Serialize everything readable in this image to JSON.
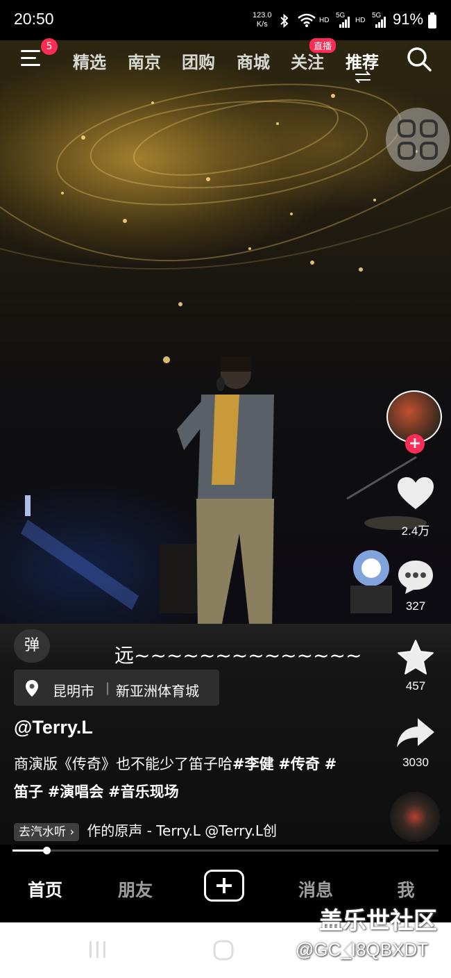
{
  "status_bar": {
    "time": "20:50",
    "net_speed_value": "123.0",
    "net_speed_unit": "K/s",
    "hd1": "HD",
    "net1": "5G",
    "hd2": "HD",
    "net2": "5G",
    "battery": "91%"
  },
  "top_nav": {
    "menu_badge": "5",
    "tabs": [
      {
        "label": "精选"
      },
      {
        "label": "南京"
      },
      {
        "label": "团购"
      },
      {
        "label": "商城"
      },
      {
        "label": "关注"
      },
      {
        "label": "推荐"
      }
    ],
    "live_badge": "直播",
    "active_tab": "推荐"
  },
  "rail": {
    "likes": "2.4万",
    "comments": "327",
    "favorites": "457",
    "shares": "3030"
  },
  "video": {
    "danmaku_label": "弹",
    "floating_comment": "远~~~~~~~~~~~~~~",
    "location_city": "昆明市",
    "location_place": "新亚洲体育城",
    "author": "@Terry.L",
    "caption_text": "商演版《传奇》也不能少了笛子哈",
    "hashtags": [
      "#李健",
      "#传奇",
      "#笛子",
      "#演唱会",
      "#音乐现场"
    ],
    "music_tag": "去汽水听",
    "music_text": "作的原声 - Terry.L    @Terry.L创",
    "progress": 0.08
  },
  "bottom_tabs": {
    "home": "首页",
    "friends": "朋友",
    "messages": "消息",
    "me": "我"
  },
  "watermark": {
    "site": "盖乐世社区",
    "user": "@GC_I8QBXDT"
  },
  "colors": {
    "accent": "#fe2c55",
    "background": "#000000"
  }
}
